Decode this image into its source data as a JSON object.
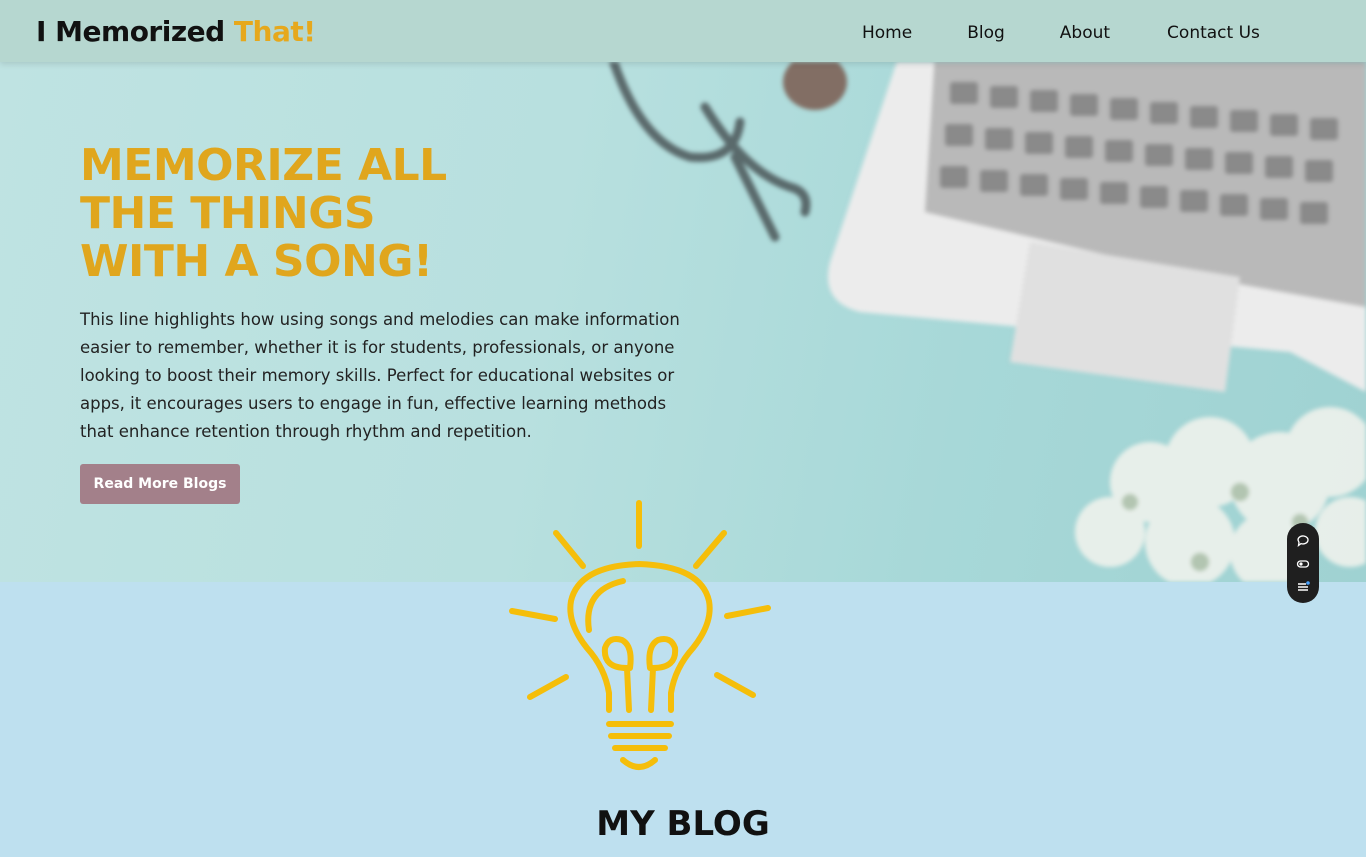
{
  "brand": {
    "name_main": "I Memorized ",
    "name_accent": "That!",
    "accent_color": "#e6a81c"
  },
  "nav": {
    "items": [
      "Home",
      "Blog",
      "About",
      "Contact Us"
    ]
  },
  "hero": {
    "title_lines": [
      "MEMORIZE ALL",
      "THE THINGS",
      "WITH A SONG!"
    ],
    "description": "This line highlights how using songs and melodies can make information easier to remember, whether it is for students, professionals, or anyone looking to boost their memory skills. Perfect for educational websites or apps, it encourages users to engage in fun, effective learning methods that enhance retention through rhythm and repetition.",
    "button_label": "Read More Blogs",
    "button_color": "#a3808a",
    "title_color": "#e0a61d"
  },
  "widget": {
    "icons": [
      "chat-icon",
      "toggle-icon",
      "list-icon"
    ]
  },
  "blog": {
    "illustration": "lightbulb-icon",
    "title": "MY BLOG"
  }
}
